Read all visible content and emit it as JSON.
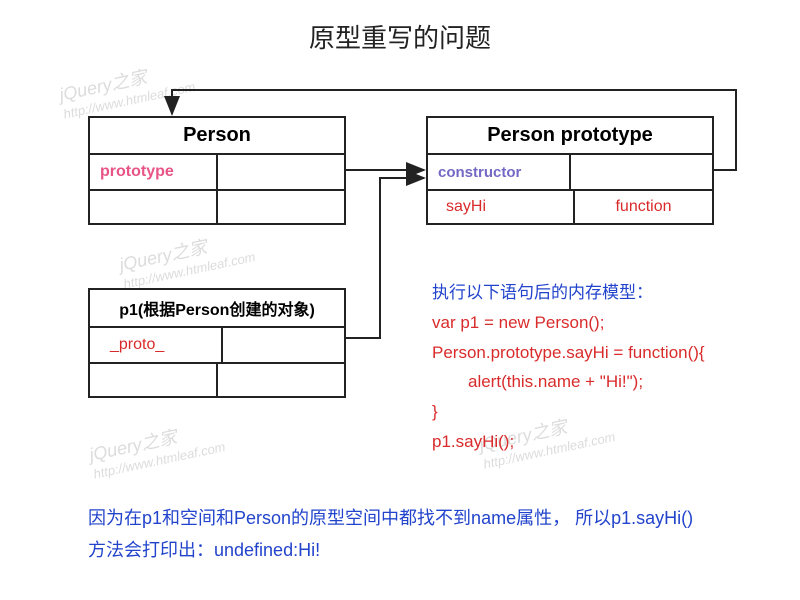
{
  "title": "原型重写的问题",
  "watermark": {
    "line1": "jQuery之家",
    "line2": "http://www.htmleaf.com"
  },
  "personBox": {
    "header": "Person",
    "row1": {
      "left": "prototype",
      "right": ""
    },
    "row2": {
      "left": "",
      "right": ""
    }
  },
  "prototypeBox": {
    "header": "Person prototype",
    "row1": {
      "left": "constructor",
      "right": ""
    },
    "row2": {
      "left": "sayHi",
      "right": "function"
    }
  },
  "p1Box": {
    "header": "p1(根据Person创建的对象)",
    "row1": {
      "left": "_proto_",
      "right": ""
    },
    "row2": {
      "left": "",
      "right": ""
    }
  },
  "code": {
    "header": "执行以下语句后的内存模型：",
    "l1": "var p1 = new Person();",
    "l2": "Person.prototype.sayHi = function(){",
    "l3": "alert(this.name + \"Hi!\");",
    "l4": "}",
    "l5": "p1.sayHi();"
  },
  "footer": {
    "l1": "因为在p1和空间和Person的原型空间中都找不到name属性，  所以p1.sayHi()",
    "l2": "方法会打印出：undefined:Hi!"
  }
}
